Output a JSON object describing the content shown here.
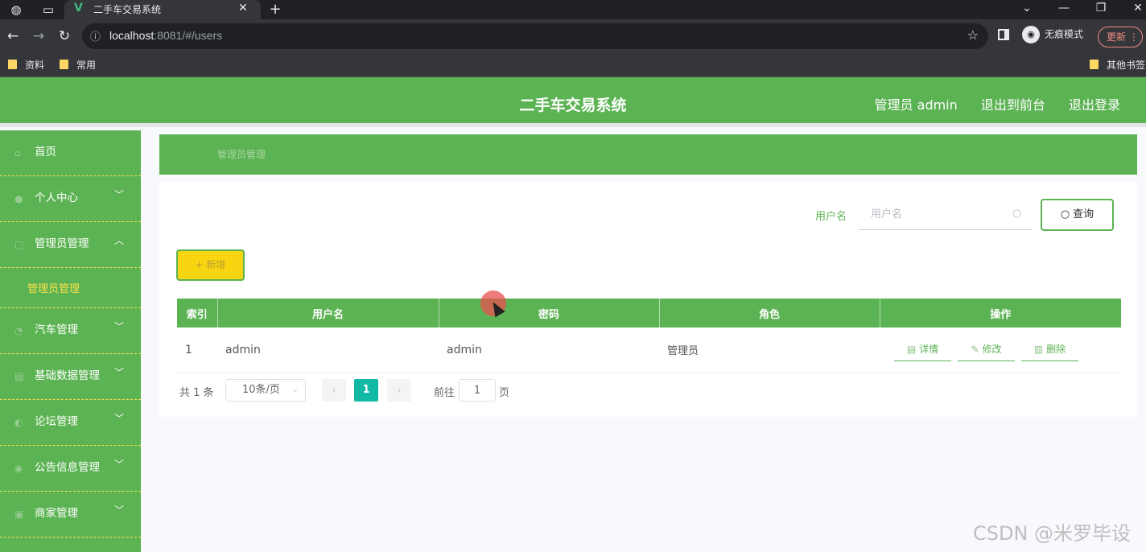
{
  "browser": {
    "tab_title": "二手车交易系统",
    "url_host": "localhost",
    "url_rest": ":8081/#/users",
    "incognito_label": "无痕模式",
    "update_label": "更新",
    "bookmarks": [
      "资料",
      "常用"
    ],
    "other_bookmarks": "其他书签"
  },
  "header": {
    "title": "二手车交易系统",
    "user": "管理员 admin",
    "to_front": "退出到前台",
    "logout": "退出登录"
  },
  "sidebar": {
    "items": [
      {
        "label": "首页",
        "icon": "home-icon",
        "arrow": ""
      },
      {
        "label": "个人中心",
        "icon": "user-icon",
        "arrow": "﹀"
      },
      {
        "label": "管理员管理",
        "icon": "admin-icon",
        "arrow": "︿"
      },
      {
        "label": "汽车管理",
        "icon": "car-icon",
        "arrow": "﹀"
      },
      {
        "label": "基础数据管理",
        "icon": "data-icon",
        "arrow": "﹀"
      },
      {
        "label": "论坛管理",
        "icon": "forum-icon",
        "arrow": "﹀"
      },
      {
        "label": "公告信息管理",
        "icon": "notice-icon",
        "arrow": "﹀"
      },
      {
        "label": "商家管理",
        "icon": "shop-icon",
        "arrow": "﹀"
      }
    ],
    "sub_item": "管理员管理"
  },
  "breadcrumb": "管理员管理",
  "search": {
    "label": "用户名",
    "placeholder": "用户名",
    "button": "查询"
  },
  "add_button": "新增",
  "table": {
    "headers": [
      "索引",
      "用户名",
      "密码",
      "角色",
      "操作"
    ],
    "rows": [
      {
        "index": "1",
        "username": "admin",
        "password": "admin",
        "role": "管理员"
      }
    ],
    "actions": {
      "detail": "详情",
      "edit": "修改",
      "delete": "删除"
    }
  },
  "pagination": {
    "total": "共 1 条",
    "page_size": "10条/页",
    "current": "1",
    "goto_label": "前往",
    "goto_value": "1",
    "goto_suffix": "页"
  },
  "watermark": "CSDN @米罗毕设",
  "colors": {
    "primary_green": "#5cb353",
    "accent_yellow": "#f7d511",
    "page_active": "#11b8a4"
  }
}
